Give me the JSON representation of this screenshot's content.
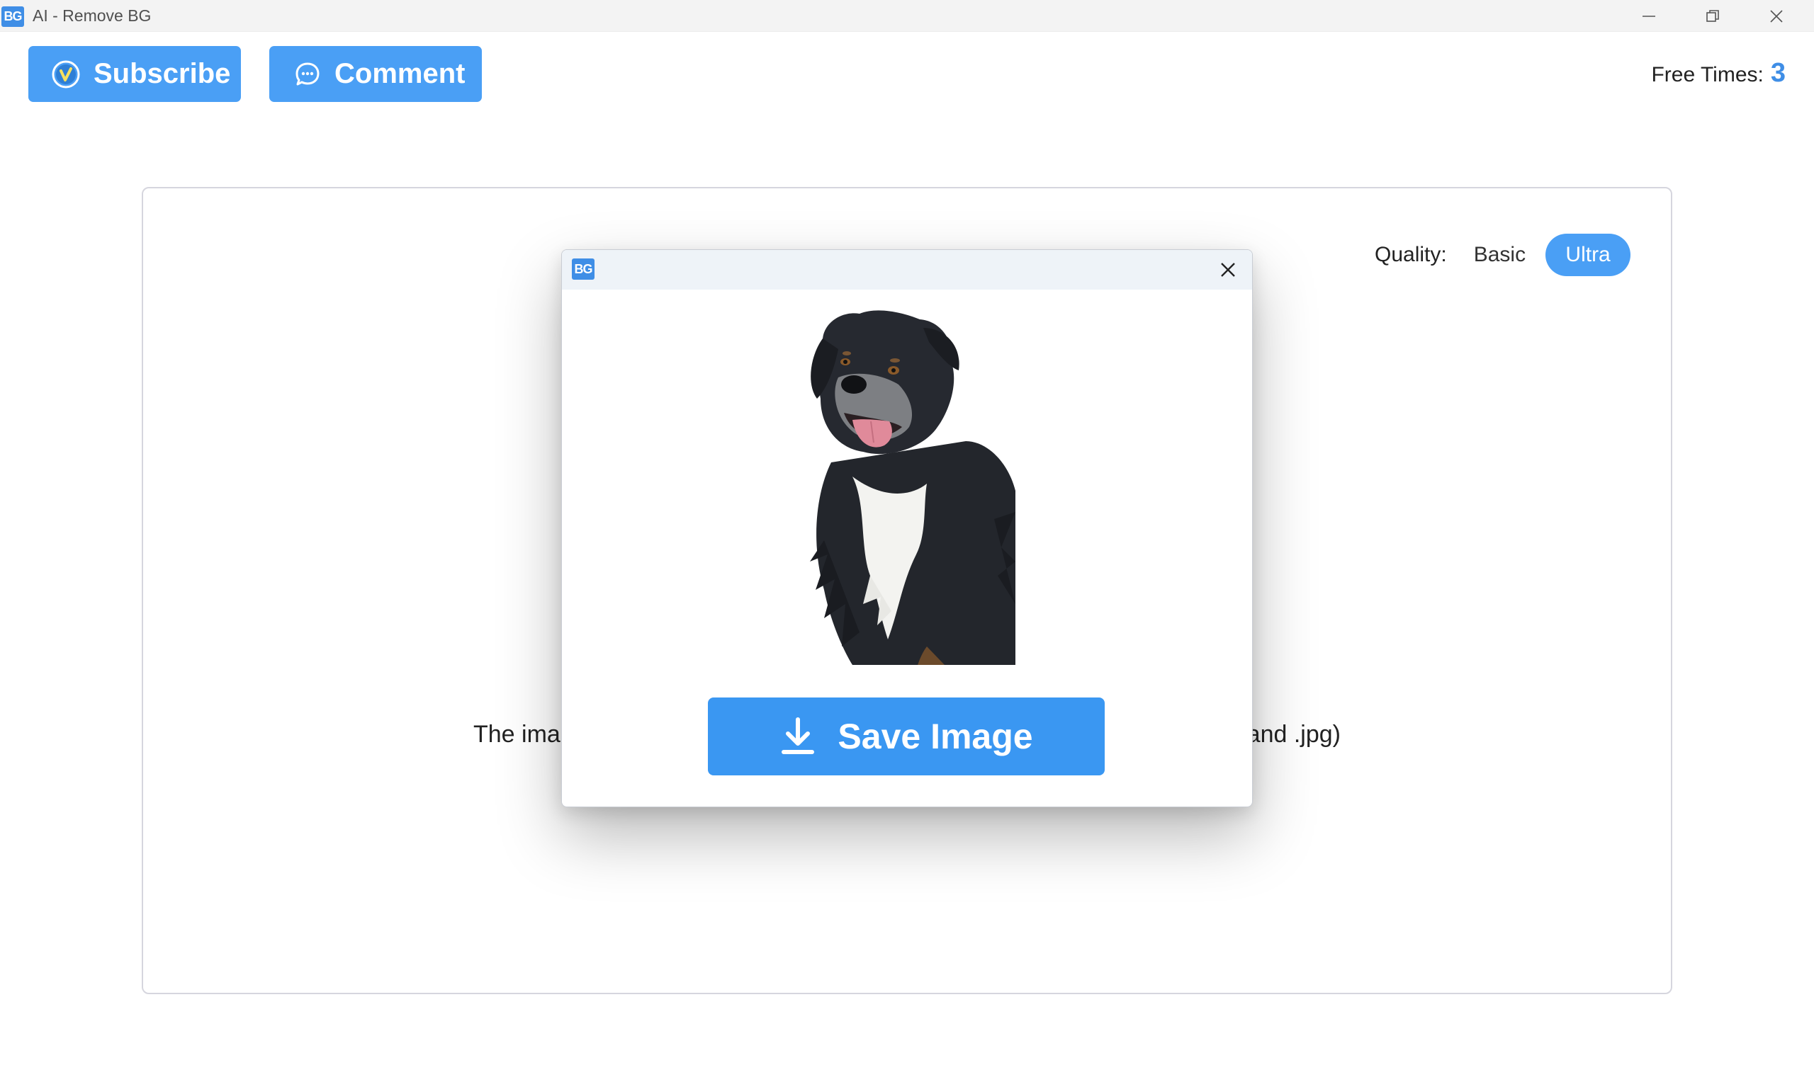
{
  "window": {
    "logo_text": "BG",
    "title": "AI - Remove BG"
  },
  "toolbar": {
    "subscribe_label": "Subscribe",
    "comment_label": "Comment",
    "free_times_label": "Free Times:",
    "free_times_count": "3"
  },
  "panel": {
    "quality_label": "Quality:",
    "quality_options": [
      "Basic",
      "Ultra"
    ],
    "quality_selected": "Ultra",
    "hint_left": "The ima",
    "hint_right": "and .jpg)"
  },
  "dialog": {
    "logo_text": "BG",
    "save_label": "Save Image",
    "image_subject": "dog-cutout"
  },
  "colors": {
    "accent": "#4a9ff5",
    "count": "#3f8ee6"
  },
  "icons": {
    "subscribe": "check-circle-icon",
    "comment": "chat-bubble-icon",
    "save": "download-icon",
    "close": "close-icon"
  }
}
